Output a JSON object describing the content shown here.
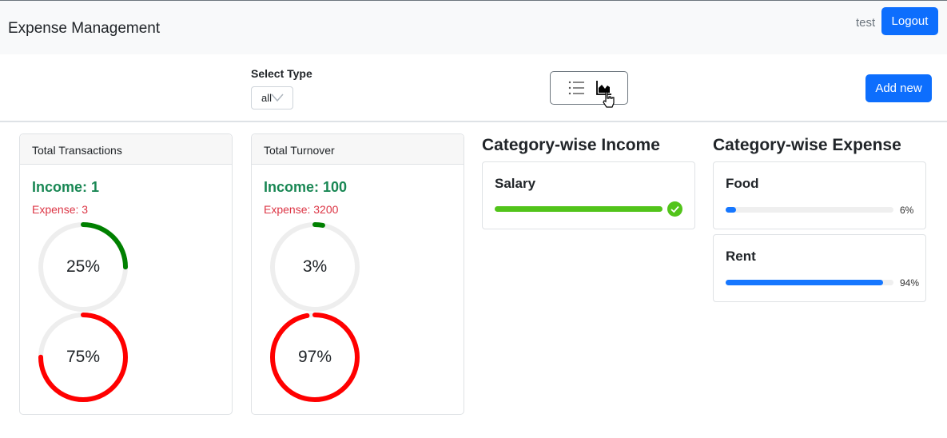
{
  "header": {
    "title": "Expense Management",
    "user": "test",
    "logout_label": "Logout"
  },
  "filter": {
    "select_label": "Select Type",
    "select_value": "all",
    "view_icons": [
      "list-icon",
      "area-chart-icon"
    ],
    "add_label": "Add new"
  },
  "transactions": {
    "title": "Total Transactions",
    "income": "Income: 1",
    "expense": "Expense: 3",
    "income_pct": "25%",
    "expense_pct": "75%",
    "income_fraction": 0.25,
    "expense_fraction": 0.75
  },
  "turnover": {
    "title": "Total Turnover",
    "income": "Income: 100",
    "expense": "Expense: 3200",
    "income_pct": "3%",
    "expense_pct": "97%",
    "income_fraction": 0.03,
    "expense_fraction": 0.97
  },
  "income_categories": {
    "title": "Category-wise Income",
    "items": [
      {
        "name": "Salary",
        "percent": 100,
        "status": "complete"
      }
    ]
  },
  "expense_categories": {
    "title": "Category-wise Expense",
    "items": [
      {
        "name": "Food",
        "percent": 6,
        "label": "6%"
      },
      {
        "name": "Rent",
        "percent": 94,
        "label": "94%"
      }
    ]
  },
  "colors": {
    "primary": "#0d6efd",
    "income_ring": "#008000",
    "expense_ring": "#ff0000",
    "success_bar": "#52c41a",
    "progress_bar": "#1677ff"
  }
}
